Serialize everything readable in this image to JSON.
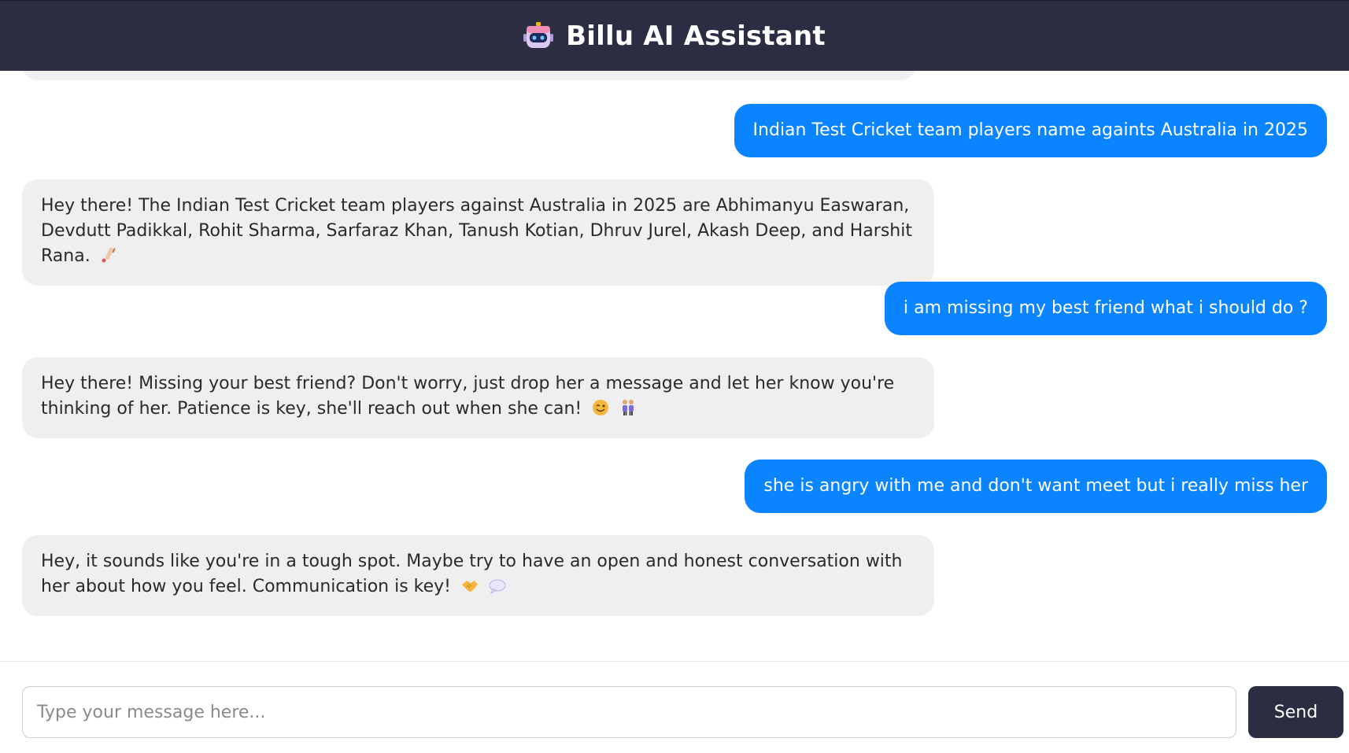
{
  "header": {
    "title": "Billu AI Assistant",
    "icon": "robot-icon"
  },
  "colors": {
    "header_bg": "#2b2d42",
    "user_bubble": "#0a84ff",
    "bot_bubble": "#efefef",
    "send_button": "#2b2d42"
  },
  "messages": [
    {
      "role": "user",
      "text": "Indian Test Cricket team players name againts Australia in 2025"
    },
    {
      "role": "bot",
      "text": "Hey there! The Indian Test Cricket team players against Australia in 2025 are Abhimanyu Easwaran, Devdutt Padikkal, Rohit Sharma, Sarfaraz Khan, Tanush Kotian, Dhruv Jurel, Akash Deep, and Harshit Rana.",
      "emojis": [
        "cricket-bat-icon"
      ]
    },
    {
      "role": "user",
      "text": "i am missing my best friend what i should do ?"
    },
    {
      "role": "bot",
      "text": "Hey there! Missing your best friend? Don't worry, just drop her a message and let her know you're thinking of her. Patience is key, she'll reach out when she can!",
      "emojis": [
        "winking-face-icon",
        "two-people-icon"
      ]
    },
    {
      "role": "user",
      "text": "she is angry with me and don't want meet but i really miss her"
    },
    {
      "role": "bot",
      "text": "Hey, it sounds like you're in a tough spot. Maybe try to have an open and honest conversation with her about how you feel. Communication is key!",
      "emojis": [
        "handshake-icon",
        "speech-bubble-icon"
      ]
    }
  ],
  "composer": {
    "placeholder": "Type your message here...",
    "value": "",
    "send_label": "Send"
  }
}
